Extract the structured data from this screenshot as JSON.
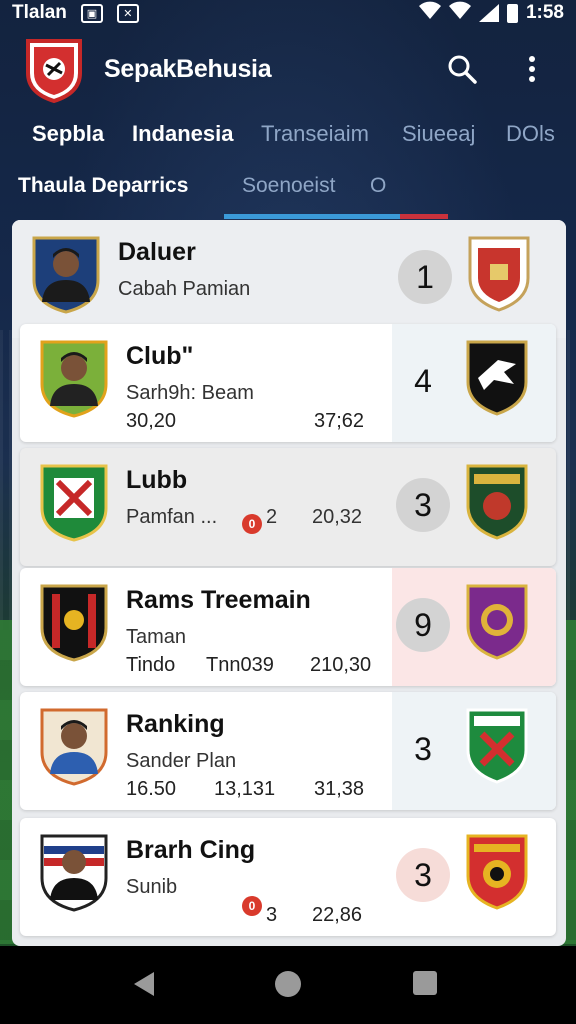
{
  "status_bar": {
    "carrier": "Tlalan",
    "time": "1:58"
  },
  "app": {
    "title": "SepakBehusia"
  },
  "tabs_primary": [
    {
      "label": "Sepbla",
      "active": true
    },
    {
      "label": "Indanesia",
      "active": true
    },
    {
      "label": "Transeiaim",
      "active": false
    },
    {
      "label": "Siueeaj",
      "active": false
    },
    {
      "label": "DOls",
      "active": false
    }
  ],
  "tabs_secondary": [
    {
      "label": "Thaula Deparrics",
      "active": true
    },
    {
      "label": "Soenoeist",
      "active": false
    },
    {
      "label": "O",
      "active": false
    }
  ],
  "rows": [
    {
      "name": "Daluer",
      "subtitle": "Cabah Pamian",
      "stat1": "",
      "stat2": "",
      "stat3": "",
      "rank": "1",
      "badge": ""
    },
    {
      "name": "Club\"",
      "subtitle": "Sarh9h: Beam",
      "stat1": "30,20",
      "stat2": "",
      "stat3": "37;62",
      "rank": "4",
      "badge": ""
    },
    {
      "name": "Lubb",
      "subtitle": "Pamfan ...",
      "stat1": "",
      "stat2": "2",
      "stat3": "20,32",
      "rank": "3",
      "badge": "0"
    },
    {
      "name": "Rams Treemain",
      "subtitle": "Taman",
      "stat1": "Tindo",
      "stat2": "Tnn039",
      "stat3": "210,30",
      "rank": "9",
      "badge": ""
    },
    {
      "name": "Ranking",
      "subtitle": "Sander Plan",
      "stat1": "16.50",
      "stat2": "13,131",
      "stat3": "31,38",
      "rank": "3",
      "badge": ""
    },
    {
      "name": "Brarh Cing",
      "subtitle": "Sunib",
      "stat1": "",
      "stat2": "3",
      "stat3": "22,86",
      "rank": "3",
      "badge": "0"
    }
  ],
  "colors": {
    "background": "#13233f",
    "active_tab_indicator": "#3b9ad8",
    "secondary_indicator": "#c9323c",
    "badge_red": "#d93a2c"
  },
  "icons": {
    "search": "search-icon",
    "more": "more-vert-icon",
    "back": "back-icon",
    "home": "home-icon",
    "recents": "recents-icon"
  }
}
